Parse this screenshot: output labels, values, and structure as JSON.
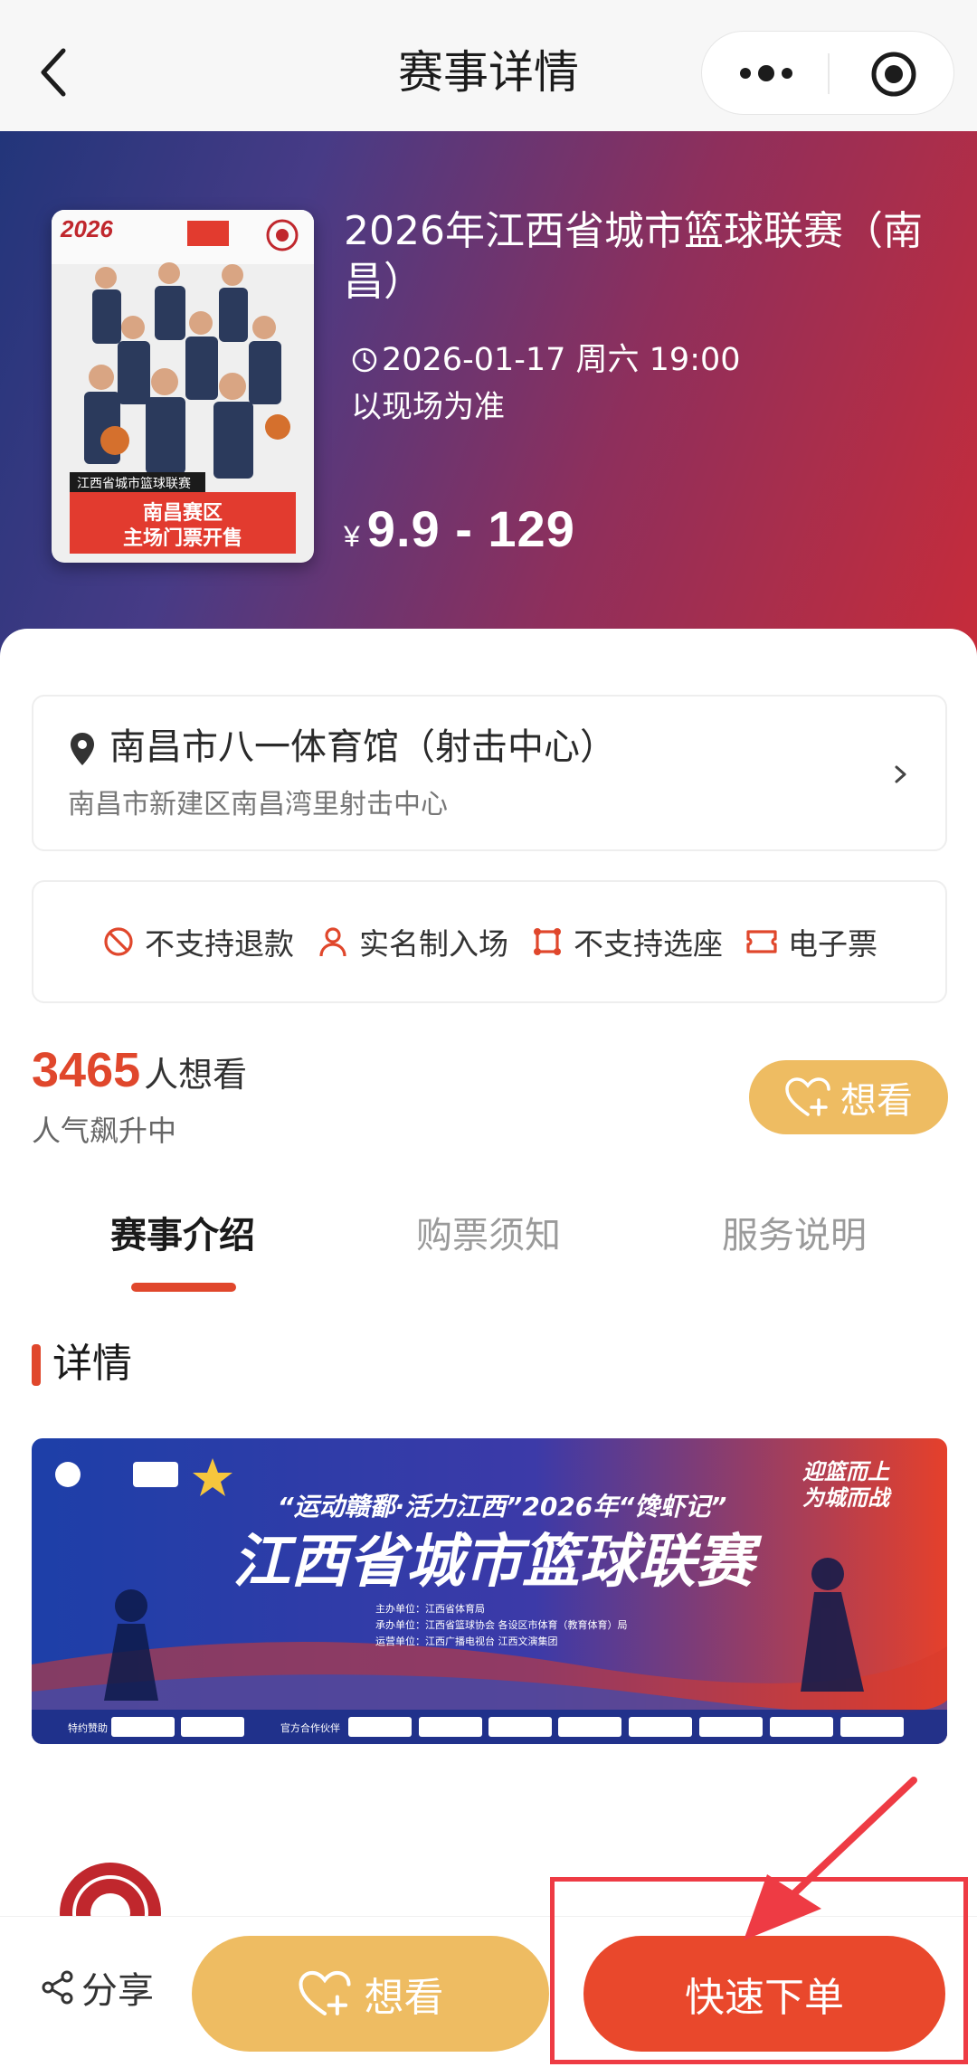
{
  "nav": {
    "title": "赛事详情"
  },
  "event": {
    "title": "2026年江西省城市篮球联赛（南昌）",
    "datetime": "2026-01-17 周六 19:00",
    "time_note": "以现场为准",
    "price_currency": "¥",
    "price_range": "9.9 - 129"
  },
  "poster": {
    "year": "2026",
    "league_tag": "江西省城市篮球联赛",
    "line1": "南昌赛区",
    "line2": "主场门票开售"
  },
  "venue": {
    "name": "南昌市八一体育馆（射击中心）",
    "address": "南昌市新建区南昌湾里射击中心"
  },
  "policies": [
    {
      "label": "不支持退款",
      "icon": "no-refund-icon"
    },
    {
      "label": "实名制入场",
      "icon": "person-icon"
    },
    {
      "label": "不支持选座",
      "icon": "seat-icon"
    },
    {
      "label": "电子票",
      "icon": "ticket-icon"
    }
  ],
  "interest": {
    "count": "3465",
    "count_suffix": "人想看",
    "trend": "人气飙升中",
    "button": "想看"
  },
  "tabs": [
    {
      "label": "赛事介绍",
      "active": true
    },
    {
      "label": "购票须知",
      "active": false
    },
    {
      "label": "服务说明",
      "active": false
    }
  ],
  "section": {
    "title": "详情"
  },
  "banner": {
    "slogan": "“运动赣鄱·活力江西”2026年“馋虾记”",
    "main_title": "江西省城市篮球联赛",
    "corner_slogan_1": "迎篮而上",
    "corner_slogan_2": "为城而战",
    "organizer": "主办单位：江西省体育局",
    "co_organizer": "承办单位：江西省篮球协会 各设区市体育（教育体育）局",
    "operator": "运营单位：江西广播电视台 江西文演集团",
    "sponsor_label": "特约赞助",
    "partner_label": "官方合作伙伴"
  },
  "bottom": {
    "share": "分享",
    "want": "想看",
    "order": "快速下单"
  },
  "colors": {
    "accent": "#e0472c",
    "gold": "#eebc62",
    "highlight": "#ee3b44"
  }
}
